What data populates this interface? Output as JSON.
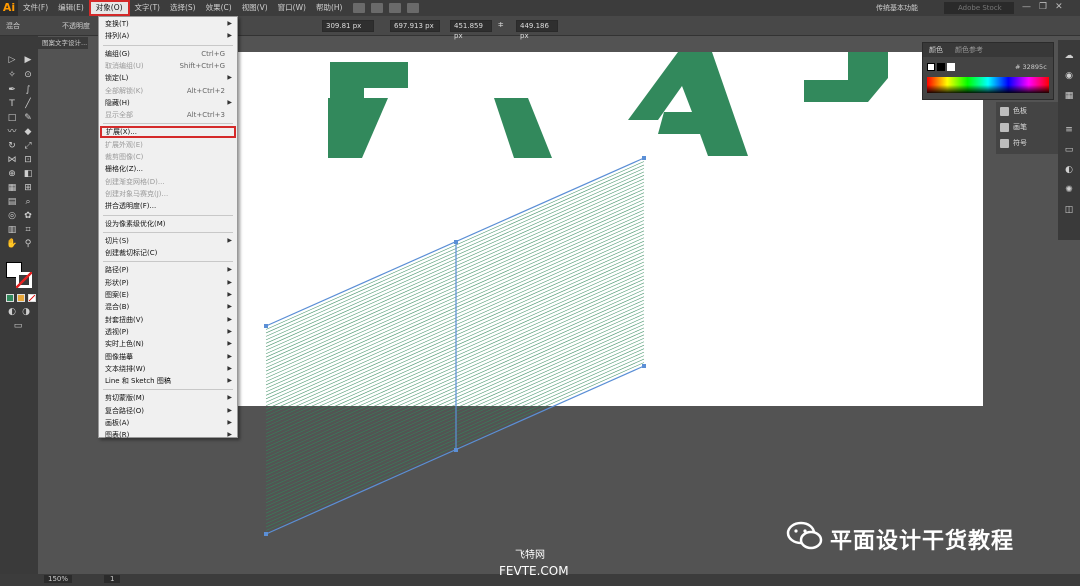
{
  "app": {
    "logo": "Ai",
    "workspace": "传统基本功能",
    "stock_search": "Adobe Stock"
  },
  "menubar": {
    "items": [
      "文件(F)",
      "编辑(E)",
      "对象(O)",
      "文字(T)",
      "选择(S)",
      "效果(C)",
      "视图(V)",
      "窗口(W)",
      "帮助(H)"
    ],
    "active_index": 2
  },
  "window_controls": {
    "minimize": "—",
    "restore": "❐",
    "close": "✕"
  },
  "controlbar": {
    "mode_label": "混合",
    "opacity_label": "不透明度",
    "x_value": "309.81 px",
    "y_value": "697.913 px",
    "w_value": "451.859 px",
    "h_value": "449.186 px",
    "lock_label": "ⵐ"
  },
  "document_tab": {
    "title": "图案文字设计..."
  },
  "object_menu": {
    "items": [
      {
        "label": "变换(T)",
        "submenu": true
      },
      {
        "label": "排列(A)",
        "submenu": true
      },
      {
        "sep": true
      },
      {
        "label": "编组(G)",
        "shortcut": "Ctrl+G"
      },
      {
        "label": "取消编组(U)",
        "shortcut": "Shift+Ctrl+G",
        "disabled": true
      },
      {
        "label": "锁定(L)",
        "submenu": true
      },
      {
        "label": "全部解锁(K)",
        "shortcut": "Alt+Ctrl+2",
        "disabled": true
      },
      {
        "label": "隐藏(H)",
        "submenu": true
      },
      {
        "label": "显示全部",
        "shortcut": "Alt+Ctrl+3",
        "disabled": true
      },
      {
        "sep": true
      },
      {
        "label": "扩展(X)...",
        "highlight": true
      },
      {
        "label": "扩展外观(E)",
        "disabled": true
      },
      {
        "label": "裁剪图像(C)",
        "disabled": true
      },
      {
        "label": "栅格化(Z)..."
      },
      {
        "label": "创建渐变网格(D)...",
        "disabled": true
      },
      {
        "label": "创建对象马赛克(J)...",
        "disabled": true
      },
      {
        "label": "拼合透明度(F)..."
      },
      {
        "sep": true
      },
      {
        "label": "设为像素级优化(M)"
      },
      {
        "sep": true
      },
      {
        "label": "切片(S)",
        "submenu": true
      },
      {
        "label": "创建裁切标记(C)"
      },
      {
        "sep": true
      },
      {
        "label": "路径(P)",
        "submenu": true
      },
      {
        "label": "形状(P)",
        "submenu": true
      },
      {
        "label": "图案(E)",
        "submenu": true
      },
      {
        "label": "混合(B)",
        "submenu": true
      },
      {
        "label": "封套扭曲(V)",
        "submenu": true
      },
      {
        "label": "透视(P)",
        "submenu": true
      },
      {
        "label": "实时上色(N)",
        "submenu": true
      },
      {
        "label": "图像描摹",
        "submenu": true
      },
      {
        "label": "文本绕排(W)",
        "submenu": true
      },
      {
        "label": "Line 和 Sketch 图稿",
        "submenu": true
      },
      {
        "sep": true
      },
      {
        "label": "剪切蒙版(M)",
        "submenu": true
      },
      {
        "label": "复合路径(O)",
        "submenu": true
      },
      {
        "label": "画板(A)",
        "submenu": true
      },
      {
        "label": "图表(R)",
        "submenu": true
      }
    ]
  },
  "color_panel": {
    "tabs": [
      "颜色",
      "颜色参考"
    ],
    "hex": "# 32895c"
  },
  "swatch_panel": {
    "items": [
      "色板",
      "画笔",
      "符号"
    ]
  },
  "status": {
    "zoom": "150%",
    "page": "1"
  },
  "colors": {
    "accent_green": "#32895c",
    "path_blue": "#5b8fd6",
    "menu_highlight": "#d42a2a"
  },
  "watermark": {
    "title": "平面设计干货教程",
    "site_cn": "飞特网",
    "site_en": "FEVTE.COM"
  }
}
